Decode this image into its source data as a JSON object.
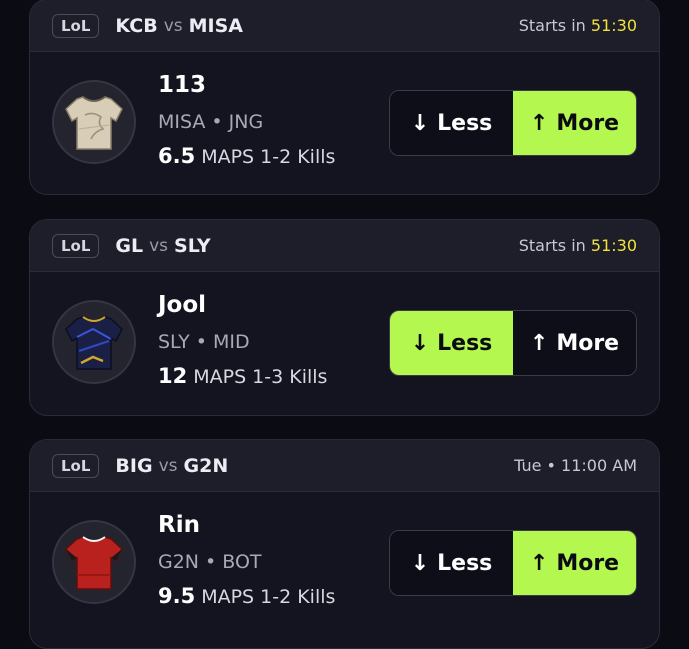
{
  "cards": [
    {
      "league": "LoL",
      "team_a": "KCB",
      "vs": "vs",
      "team_b": "MISA",
      "time_prefix": "Starts in",
      "time_value": "51:30",
      "player": "113",
      "team": "MISA",
      "position": "JNG",
      "line": "6.5",
      "stat": "MAPS 1-2 Kills",
      "less_label": "Less",
      "more_label": "More",
      "selected": "more",
      "jersey_color": "#d8cdb7"
    },
    {
      "league": "LoL",
      "team_a": "GL",
      "vs": "vs",
      "team_b": "SLY",
      "time_prefix": "Starts in",
      "time_value": "51:30",
      "player": "Jool",
      "team": "SLY",
      "position": "MID",
      "line": "12",
      "stat": "MAPS 1-3 Kills",
      "less_label": "Less",
      "more_label": "More",
      "selected": "less",
      "jersey_color": "#1a1f46"
    },
    {
      "league": "LoL",
      "team_a": "BIG",
      "vs": "vs",
      "team_b": "G2N",
      "time_prefix": "",
      "time_value": "Tue • 11:00 AM",
      "player": "Rin",
      "team": "G2N",
      "position": "BOT",
      "line": "9.5",
      "stat": "MAPS 1-2 Kills",
      "less_label": "Less",
      "more_label": "More",
      "selected": "more",
      "jersey_color": "#b8211e"
    }
  ],
  "colors": {
    "accent": "#b4f84f",
    "countdown": "#f2e23a",
    "background": "#0b0b13",
    "card": "#141420"
  },
  "icons": {
    "down_arrow": "arrow-down-icon",
    "up_arrow": "arrow-up-icon",
    "jersey": "jersey-icon"
  },
  "glyphs": {
    "down": "↓",
    "up": "↑",
    "dot": "•"
  }
}
